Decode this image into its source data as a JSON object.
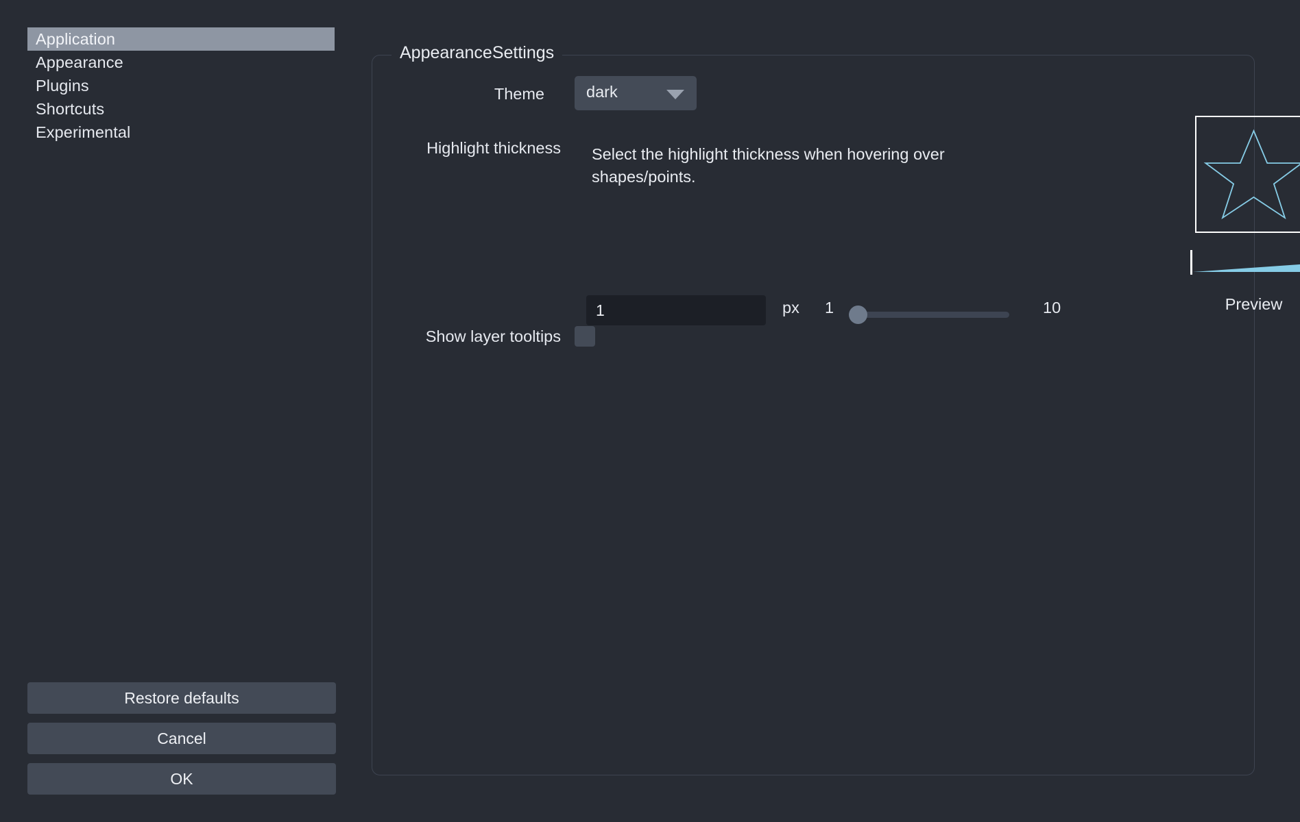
{
  "sidebar": {
    "items": [
      {
        "label": "Application",
        "selected": true
      },
      {
        "label": "Appearance",
        "selected": false
      },
      {
        "label": "Plugins",
        "selected": false
      },
      {
        "label": "Shortcuts",
        "selected": false
      },
      {
        "label": "Experimental",
        "selected": false
      }
    ],
    "buttons": {
      "restore_defaults": "Restore defaults",
      "cancel": "Cancel",
      "ok": "OK"
    }
  },
  "settings": {
    "group_title": "AppearanceSettings",
    "theme": {
      "label": "Theme",
      "value": "dark",
      "options": [
        "dark"
      ]
    },
    "highlight_thickness": {
      "label": "Highlight thickness",
      "description": "Select the highlight thickness when hovering over shapes/points.",
      "value": "1",
      "unit": "px",
      "slider_min": "1",
      "slider_max": "10",
      "preview_label": "Preview"
    },
    "show_layer_tooltips": {
      "label": "Show layer tooltips",
      "checked": false
    }
  },
  "colors": {
    "background": "#282c34",
    "selection": "#8e96a3",
    "button": "#434a56",
    "field": "#1c1f26",
    "accent_blue": "#86cce6",
    "border": "#3e4451",
    "text": "#e6e9ef"
  }
}
